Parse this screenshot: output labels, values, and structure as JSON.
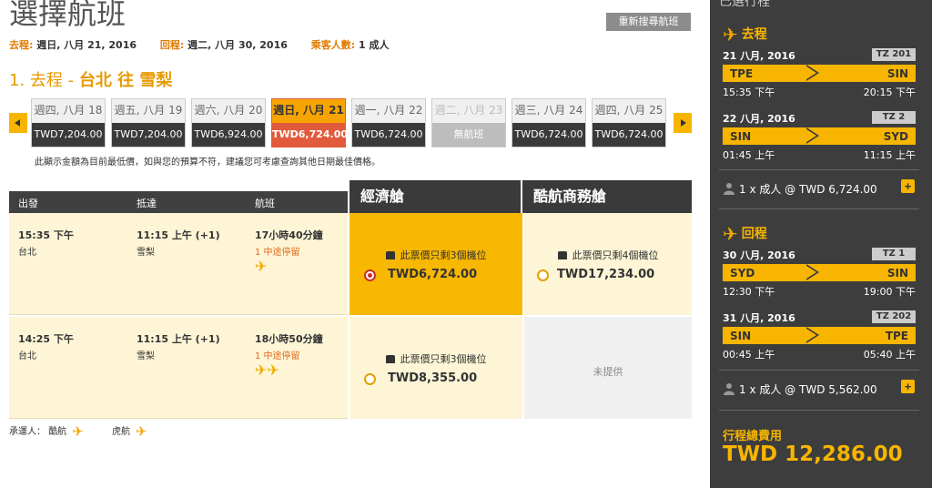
{
  "page": {
    "title": "選擇航班",
    "search_again": "重新搜尋航班",
    "summary": {
      "depart_label": "去程:",
      "depart_value": "週日, 八月 21, 2016",
      "return_label": "回程:",
      "return_value": "週二, 八月 30, 2016",
      "pax_label": "乘客人數:",
      "pax_value": "1 成人"
    },
    "section": {
      "prefix": "1. 去程 - ",
      "route": "台北 往 雪梨"
    },
    "dates": [
      {
        "day": "週四, 八月 18",
        "price": "TWD7,204.00",
        "state": "normal"
      },
      {
        "day": "週五, 八月 19",
        "price": "TWD7,204.00",
        "state": "normal"
      },
      {
        "day": "週六, 八月 20",
        "price": "TWD6,924.00",
        "state": "normal"
      },
      {
        "day": "週日, 八月 21",
        "price": "TWD6,724.00",
        "state": "selected"
      },
      {
        "day": "週一, 八月 22",
        "price": "TWD6,724.00",
        "state": "normal"
      },
      {
        "day": "週二, 八月 23",
        "price": "無航班",
        "state": "unavailable"
      },
      {
        "day": "週三, 八月 24",
        "price": "TWD6,724.00",
        "state": "normal"
      },
      {
        "day": "週四, 八月 25",
        "price": "TWD6,724.00",
        "state": "normal"
      }
    ],
    "note": "此顯示金額為目前最低價，如與您的預算不符，建議您可考慮查詢其他日期最佳價格。",
    "table": {
      "col_depart": "出發",
      "col_arrive": "抵達",
      "col_flight": "航班",
      "cabin_economy": "經濟艙",
      "cabin_business": "酷航商務艙"
    },
    "flights": [
      {
        "dep_time": "15:35 下午",
        "dep_city": "台北",
        "arr_time": "11:15 上午 (+1)",
        "arr_city": "雪梨",
        "duration": "17小時40分鐘",
        "stops": "1 中途停留",
        "planes": "✈",
        "economy": {
          "seats": "此票價只剩3個機位",
          "price": "TWD6,724.00",
          "selected": true
        },
        "business": {
          "seats": "此票價只剩4個機位",
          "price": "TWD17,234.00"
        }
      },
      {
        "dep_time": "14:25 下午",
        "dep_city": "台北",
        "arr_time": "11:15 上午 (+1)",
        "arr_city": "雪梨",
        "duration": "18小時50分鐘",
        "stops": "1 中途停留",
        "planes": "✈✈",
        "economy": {
          "seats": "此票價只剩3個機位",
          "price": "TWD8,355.00",
          "selected": false
        },
        "business": {
          "na": "未提供"
        }
      }
    ],
    "carriers": {
      "label": "承運人：",
      "c1": "酷航",
      "c2": "虎航"
    }
  },
  "sidebar": {
    "top": "已選行程",
    "outbound": {
      "title": "去程",
      "segments": [
        {
          "date": "21 八月, 2016",
          "fn": "TZ 201",
          "from": "TPE",
          "to": "SIN",
          "dep": "15:35 下午",
          "arr": "20:15 下午"
        },
        {
          "date": "22 八月, 2016",
          "fn": "TZ 2",
          "from": "SIN",
          "to": "SYD",
          "dep": "01:45 上午",
          "arr": "11:15 上午"
        }
      ],
      "pax": "1 x 成人 @ TWD 6,724.00"
    },
    "inbound": {
      "title": "回程",
      "segments": [
        {
          "date": "30 八月, 2016",
          "fn": "TZ 1",
          "from": "SYD",
          "to": "SIN",
          "dep": "12:30 下午",
          "arr": "19:00 下午"
        },
        {
          "date": "31 八月, 2016",
          "fn": "TZ 202",
          "from": "SIN",
          "to": "TPE",
          "dep": "00:45 上午",
          "arr": "05:40 上午"
        }
      ],
      "pax": "1 x 成人 @ TWD 5,562.00"
    },
    "plus": "+",
    "total_label": "行程總費用",
    "total_value": "TWD 12,286.00"
  },
  "colors": {
    "accent": "#f8b500",
    "selected_date": "#e25a3c",
    "dark": "#3d3d3d"
  }
}
